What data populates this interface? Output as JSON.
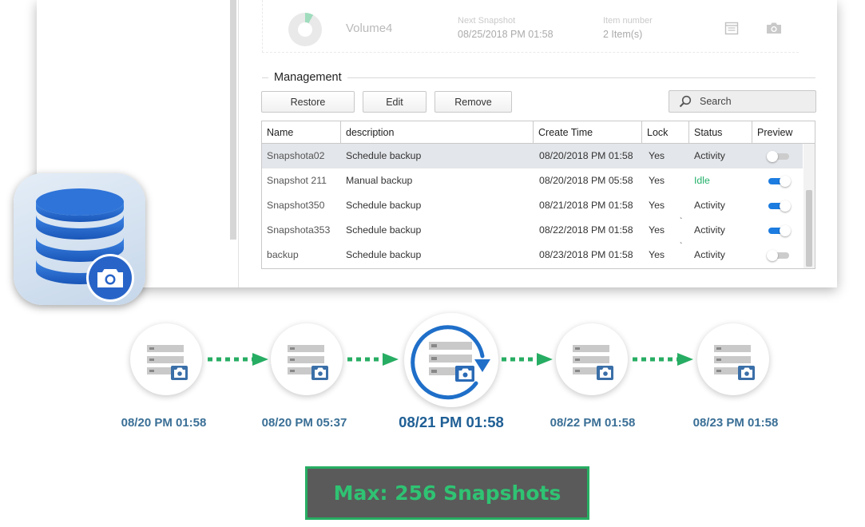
{
  "volume_card": {
    "name": "Volume4",
    "next_snapshot_label": "Next Snapshot",
    "next_snapshot_value": "08/25/2018 PM 01:58",
    "item_number_label": "Item number",
    "item_number_value": "2 Item(s)",
    "icons": [
      "calendar-icon",
      "camera-icon"
    ]
  },
  "management": {
    "title": "Management",
    "buttons": {
      "restore": "Restore",
      "edit": "Edit",
      "remove": "Remove"
    },
    "search_placeholder": "Search"
  },
  "table": {
    "columns": [
      "Name",
      "description",
      "Create Time",
      "Lock",
      "Status",
      "Preview"
    ],
    "rows": [
      {
        "name": "Snapshota02",
        "description": "Schedule backup",
        "create_time": "08/20/2018 PM 01:58",
        "lock": "Yes",
        "status": "Activity",
        "preview": false
      },
      {
        "name": "Snapshot 211",
        "description": "Manual backup",
        "create_time": "08/20/2018 PM 05:58",
        "lock": "Yes",
        "status": "Idle",
        "preview": true
      },
      {
        "name": "Snapshot350",
        "description": "Schedule backup",
        "create_time": "08/21/2018 PM 01:58",
        "lock": "Yes",
        "status": "Activity",
        "preview": true
      },
      {
        "name": "Snapshota353",
        "description": "Schedule backup",
        "create_time": "08/22/2018 PM 01:58",
        "lock": "Yes",
        "status": "Activity",
        "preview": true
      },
      {
        "name": "backup",
        "description": "Schedule backup",
        "create_time": "08/23/2018 PM 01:58",
        "lock": "Yes",
        "status": "Activity",
        "preview": false
      }
    ],
    "selected_row": 0
  },
  "app_icon": "database-camera-icon",
  "timeline": {
    "dates": [
      "08/20 PM 01:58",
      "08/20 PM 05:37",
      "08/21 PM 01:58",
      "08/22 PM 01:58",
      "08/23 PM 01:58"
    ],
    "highlighted_index": 2
  },
  "max_label": "Max: 256 Snapshots",
  "colors": {
    "accent_green": "#27ad63",
    "toggle_on": "#1c7ce0",
    "date_blue": "#3a6f96",
    "status_idle": "#23b16a",
    "app_icon_blue": "#1f63c9"
  }
}
